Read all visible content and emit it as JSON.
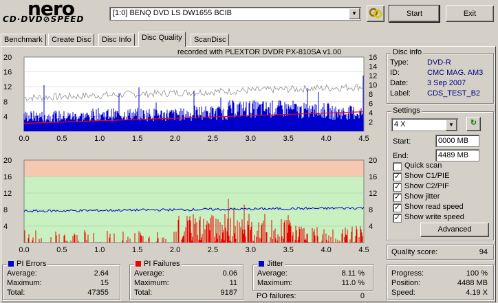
{
  "logo": {
    "top": "nero",
    "bottom": "CD·DVD⊘SPEED"
  },
  "drive": {
    "selected": "[1:0]  BENQ DVD LS DW1655 BCIB"
  },
  "buttons": {
    "start": "Start",
    "exit": "Exit",
    "advanced": "Advanced"
  },
  "tabs": [
    "Benchmark",
    "Create Disc",
    "Disc Info",
    "Disc Quality",
    "ScanDisc"
  ],
  "active_tab": "Disc Quality",
  "recorded_with": "recorded with PLEXTOR DVDR   PX-810SA  v1.00",
  "disc_info": {
    "title": "Disc info",
    "type_label": "Type:",
    "type": "DVD-R",
    "id_label": "ID:",
    "id": "CMC MAG. AM3",
    "date_label": "Date:",
    "date": "3 Sep 2007",
    "label_label": "Label:",
    "label": "CDS_TEST_B2"
  },
  "settings": {
    "title": "Settings",
    "speed": "4 X",
    "start_label": "Start:",
    "start": "0000 MB",
    "end_label": "End:",
    "end": "4489 MB",
    "options": [
      {
        "label": "Quick scan",
        "checked": false
      },
      {
        "label": "Show C1/PIE",
        "checked": true
      },
      {
        "label": "Show C2/PIF",
        "checked": true
      },
      {
        "label": "Show jitter",
        "checked": true
      },
      {
        "label": "Show read speed",
        "checked": true
      },
      {
        "label": "Show write speed",
        "checked": true
      }
    ]
  },
  "quality": {
    "label": "Quality score:",
    "value": "94"
  },
  "progress": {
    "progress_label": "Progress:",
    "progress": "100 %",
    "position_label": "Position:",
    "position": "4488 MB",
    "speed_label": "Speed:",
    "speed": "4.19 X"
  },
  "pi_errors": {
    "title": "PI Errors",
    "color": "#0000cc",
    "average_label": "Average:",
    "average": "2.64",
    "maximum_label": "Maximum:",
    "maximum": "15",
    "total_label": "Total:",
    "total": "47355"
  },
  "pi_failures": {
    "title": "PI Failures",
    "color": "#ee0000",
    "average_label": "Average:",
    "average": "0.06",
    "maximum_label": "Maximum:",
    "maximum": "11",
    "total_label": "Total:",
    "total": "9187"
  },
  "jitter": {
    "title": "Jitter",
    "color": "#0000cc",
    "average_label": "Average:",
    "average": "8.11 %",
    "maximum_label": "Maximum:",
    "maximum": "11.0 %",
    "po_label": "PO failures:",
    "po": "0"
  },
  "chart_data": [
    {
      "type": "bar",
      "name": "pi-errors-chart",
      "x_ticks": [
        "0.0",
        "0.5",
        "1.0",
        "1.5",
        "2.0",
        "2.5",
        "3.0",
        "3.5",
        "4.0",
        "4.5"
      ],
      "y_left_ticks": [
        "20",
        "16",
        "12",
        "8",
        "4"
      ],
      "y_right_ticks": [
        "16",
        "14",
        "12",
        "10",
        "8",
        "6",
        "4",
        "2"
      ],
      "xlim": [
        0,
        4.5
      ],
      "ylim_left": [
        0,
        20
      ],
      "ylim_right": [
        0,
        16
      ],
      "series": [
        {
          "name": "PI Errors",
          "color": "#0000cc",
          "approx_level": [
            4,
            4,
            4.5,
            4.5,
            4.5,
            5,
            6,
            6,
            5.5,
            5
          ]
        },
        {
          "name": "Read speed",
          "color": "#ff0000",
          "x": [
            0,
            4.5
          ],
          "y": [
            1.7,
            4.2
          ]
        }
      ]
    },
    {
      "type": "bar",
      "name": "pi-failures-chart",
      "x_ticks": [
        "0.0",
        "0.5",
        "1.0",
        "1.5",
        "2.0",
        "2.5",
        "3.0",
        "3.5",
        "4.0",
        "4.5"
      ],
      "y_left_ticks": [
        "20",
        "16",
        "12",
        "8",
        "4"
      ],
      "y_right_ticks": [
        "20",
        "16",
        "12",
        "8",
        "4"
      ],
      "xlim": [
        0,
        4.5
      ],
      "ylim": [
        0,
        20
      ],
      "bands": [
        {
          "from": 16,
          "to": 20,
          "color": "#f7c8b0"
        },
        {
          "from": 0,
          "to": 16,
          "color": "#c8f0c0"
        }
      ],
      "series": [
        {
          "name": "PI Failures",
          "color": "#ee0000"
        },
        {
          "name": "Jitter",
          "color": "#0000cc",
          "approx_level": 8
        }
      ]
    }
  ]
}
